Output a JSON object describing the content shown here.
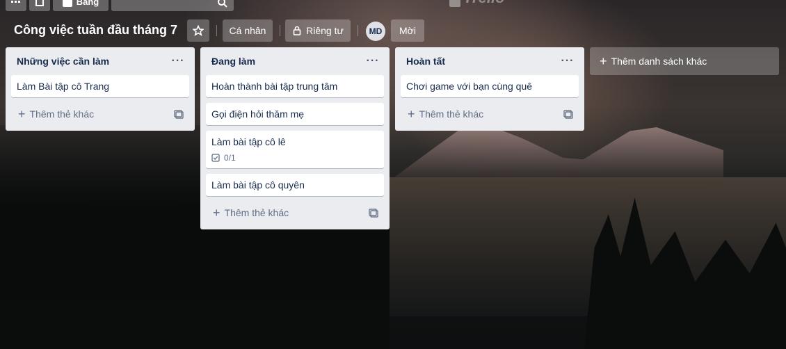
{
  "topbar": {
    "boards_label": "Bảng",
    "logo_text": "Trello"
  },
  "board": {
    "title": "Công việc tuần đầu tháng 7",
    "visibility_personal": "Cá nhân",
    "visibility_private": "Riêng tư",
    "member_initials": "MD",
    "invite_label": "Mời"
  },
  "lists": [
    {
      "title": "Những việc cần làm",
      "cards": [
        {
          "text": "Làm Bài tập cô Trang"
        }
      ],
      "add_card_label": "Thêm thẻ khác"
    },
    {
      "title": "Đang làm",
      "cards": [
        {
          "text": "Hoàn thành bài tập trung tâm"
        },
        {
          "text": "Gọi điện hỏi thăm mẹ"
        },
        {
          "text": "Làm bài tập cô lê",
          "checklist": "0/1"
        },
        {
          "text": "Làm bài tập cô quyên"
        }
      ],
      "add_card_label": "Thêm thẻ khác"
    },
    {
      "title": "Hoàn tất",
      "cards": [
        {
          "text": "Chơi game với bạn cùng quê"
        }
      ],
      "add_card_label": "Thêm thẻ khác"
    }
  ],
  "add_list_label": "Thêm danh sách khác"
}
